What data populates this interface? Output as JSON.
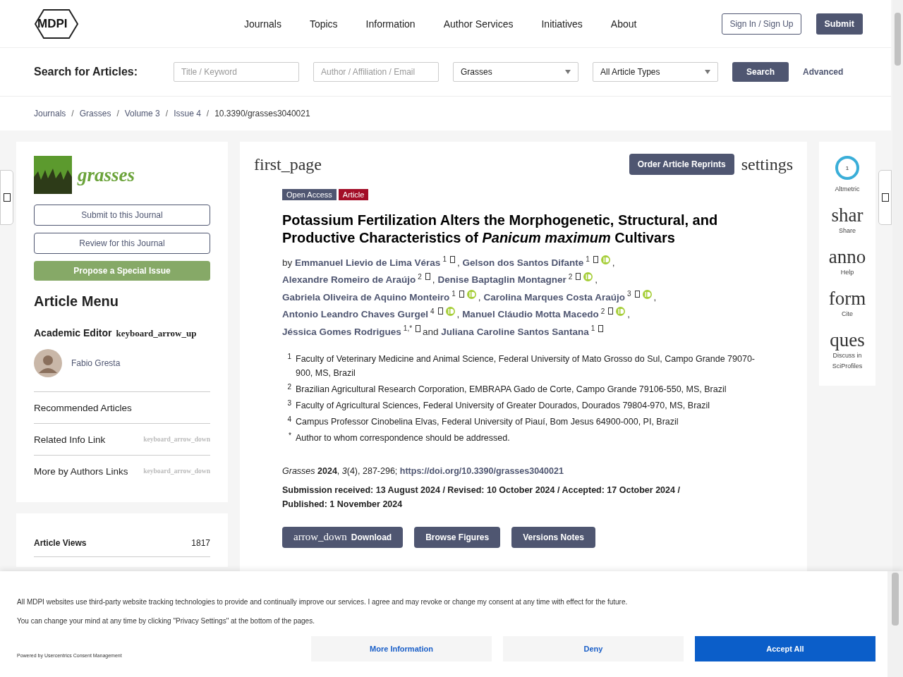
{
  "header": {
    "logo": "MDPI",
    "nav": [
      "Journals",
      "Topics",
      "Information",
      "Author Services",
      "Initiatives",
      "About"
    ],
    "sign_in": "Sign In / Sign Up",
    "submit": "Submit"
  },
  "search": {
    "label": "Search for Articles:",
    "fields": [
      {
        "placeholder": "Title / Keyword"
      },
      {
        "placeholder": "Author / Affiliation / Email"
      }
    ],
    "selects": [
      "Grasses",
      "All Article Types"
    ],
    "button": "Search",
    "advanced": "Advanced"
  },
  "breadcrumb": {
    "separator": "/",
    "items": [
      "Journals",
      "Grasses",
      "Volume 3",
      "Issue 4",
      "10.3390/grasses3040021"
    ]
  },
  "sidebar": {
    "journal_name": "grasses",
    "buttons": [
      {
        "label": "Submit to this Journal",
        "kind": "outline"
      },
      {
        "label": "Review for this Journal",
        "kind": "outline"
      },
      {
        "label": "Propose a Special Issue",
        "kind": "filled"
      }
    ],
    "menu_title": "Article Menu",
    "editor_heading": "Academic Editor",
    "editor_icon": "keyboard_arrow_up",
    "editor_name": "Fabio Gresta",
    "links": [
      {
        "label": "Recommended Articles"
      },
      {
        "label": "Related Info Link",
        "icon": "keyboard_arrow_down"
      },
      {
        "label": "More by Authors Links",
        "icon": "keyboard_arrow_down"
      }
    ],
    "views": {
      "label": "Article Views",
      "value": "1817"
    }
  },
  "article": {
    "icon_left": "first_page",
    "reprints": "Order Article Reprints",
    "icon_right": "settings",
    "badges": [
      {
        "label": "Open Access",
        "color": "#4f5671"
      },
      {
        "label": "Article",
        "color": "#a30d27"
      }
    ],
    "title": "Potassium Fertilization Alters the Morphogenetic, Structural, and Productive Characteristics of *Panicum maximum* Cultivars",
    "by": "by",
    "authors": [
      {
        "name": "Emmanuel Lievio de Lima Véras",
        "sup": "1",
        "orcid": false,
        "sep": ","
      },
      {
        "name": "Gelson dos Santos Difante",
        "sup": "1",
        "orcid": true,
        "sep": ","
      },
      {
        "name": "Alexandre Romeiro de Araújo",
        "sup": "2",
        "orcid": false,
        "sep": ","
      },
      {
        "name": "Denise Baptaglin Montagner",
        "sup": "2",
        "orcid": true,
        "sep": ","
      },
      {
        "name": "Gabriela Oliveira de Aquino Monteiro",
        "sup": "1",
        "orcid": true,
        "sep": ","
      },
      {
        "name": "Carolina Marques Costa Araújo",
        "sup": "3",
        "orcid": true,
        "sep": ","
      },
      {
        "name": "Antonio Leandro Chaves Gurgel",
        "sup": "4",
        "orcid": true,
        "sep": ","
      },
      {
        "name": "Manuel Cláudio Motta Macedo",
        "sup": "2",
        "orcid": true,
        "sep": ","
      },
      {
        "name": "Jéssica Gomes Rodrigues",
        "sup": "1,*",
        "orcid": false,
        "sep": "and"
      },
      {
        "name": "Juliana Caroline Santos Santana",
        "sup": "1",
        "orcid": false
      }
    ],
    "affiliations": [
      {
        "mark": "1",
        "text": "Faculty of Veterinary Medicine and Animal Science, Federal University of Mato Grosso do Sul, Campo Grande 79070-900, MS, Brazil"
      },
      {
        "mark": "2",
        "text": "Brazilian Agricultural Research Corporation, EMBRAPA Gado de Corte, Campo Grande 79106-550, MS, Brazil"
      },
      {
        "mark": "3",
        "text": "Faculty of Agricultural Sciences, Federal University of Greater Dourados, Dourados 79804-970, MS, Brazil"
      },
      {
        "mark": "4",
        "text": "Campus Professor Cinobelina Elvas, Federal University of Piauí, Bom Jesus 64900-000, PI, Brazil"
      },
      {
        "mark": "*",
        "text": "Author to whom correspondence should be addressed."
      }
    ],
    "citation": "*Grasses* **2024**, *3*(4), 287-296;",
    "doi": "https://doi.org/10.3390/grasses3040021",
    "dates": "Submission received: 13 August 2024 / Revised: 10 October 2024 / Accepted: 17 October 2024 / Published: 1 November 2024",
    "buttons": [
      {
        "label": "Download",
        "icon": "arrow_down"
      },
      {
        "label": "Browse Figures"
      },
      {
        "label": "Versions Notes"
      }
    ]
  },
  "side_tools": {
    "altmetric_score": "1",
    "altmetric_label": "Altmetric",
    "tools": [
      {
        "icon": "shar",
        "label": "Share"
      },
      {
        "icon": "anno",
        "label": "Help"
      },
      {
        "icon": "form",
        "label": "Cite"
      },
      {
        "icon": "ques",
        "label": "Discuss in SciProfiles"
      }
    ]
  },
  "cookie": {
    "lines": [
      "All MDPI websites use third-party website tracking technologies to provide and continually improve our services. I agree and may revoke or change my consent at any time with effect for the future.",
      "You can change your mind at any time by clicking \"Privacy Settings\" at the bottom of the pages."
    ],
    "powered": "Powered by Usercentrics Consent Management",
    "buttons": [
      {
        "label": "More Information",
        "kind": "secondary"
      },
      {
        "label": "Deny",
        "kind": "secondary"
      },
      {
        "label": "Accept All",
        "kind": "primary"
      }
    ]
  }
}
